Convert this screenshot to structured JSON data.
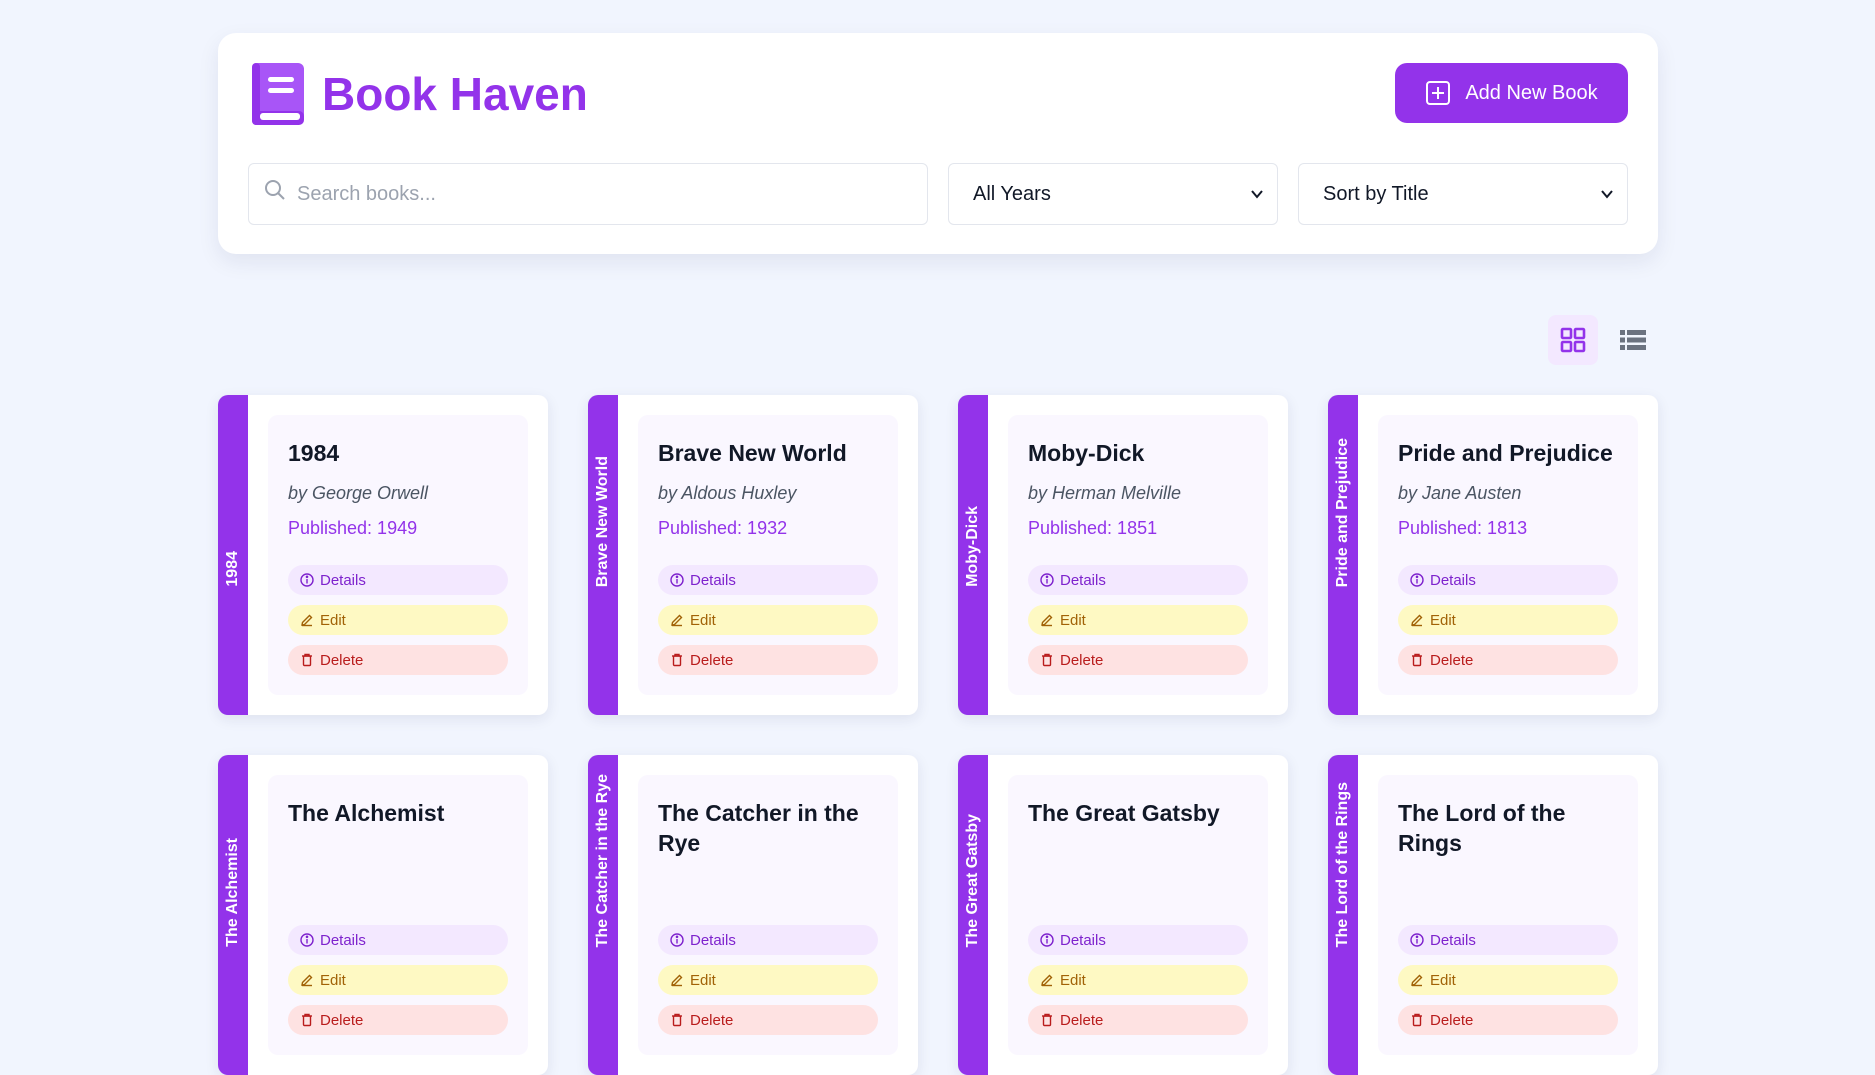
{
  "header": {
    "title": "Book Haven",
    "add_button": "Add New Book",
    "search_placeholder": "Search books...",
    "year_filter": "All Years",
    "sort_select": "Sort by Title"
  },
  "colors": {
    "accent": "#9333ea",
    "background": "#f1f5fe"
  },
  "view_toggle": {
    "active": "grid",
    "icons": [
      "grid-view-icon",
      "list-view-icon"
    ]
  },
  "actions": {
    "details": "Details",
    "edit": "Edit",
    "delete": "Delete"
  },
  "books": [
    {
      "spine": "1984",
      "title": "1984",
      "author": "by George Orwell",
      "published": "Published: 1949"
    },
    {
      "spine": "Brave New World",
      "title": "Brave New World",
      "author": "by Aldous Huxley",
      "published": "Published: 1932"
    },
    {
      "spine": "Moby-Dick",
      "title": "Moby-Dick",
      "author": "by Herman Melville",
      "published": "Published: 1851"
    },
    {
      "spine": "Pride and Prejudice",
      "title": "Pride and Prejudice",
      "author": "by Jane Austen",
      "published": "Published: 1813"
    },
    {
      "spine": "The Alchemist",
      "title": "The Alchemist",
      "author": "",
      "published": ""
    },
    {
      "spine": "The Catcher in the Rye",
      "title": "The Catcher in the Rye",
      "author": "",
      "published": ""
    },
    {
      "spine": "The Great Gatsby",
      "title": "The Great Gatsby",
      "author": "",
      "published": ""
    },
    {
      "spine": "The Lord of the Rings",
      "title": "The Lord of the Rings",
      "author": "",
      "published": ""
    }
  ]
}
